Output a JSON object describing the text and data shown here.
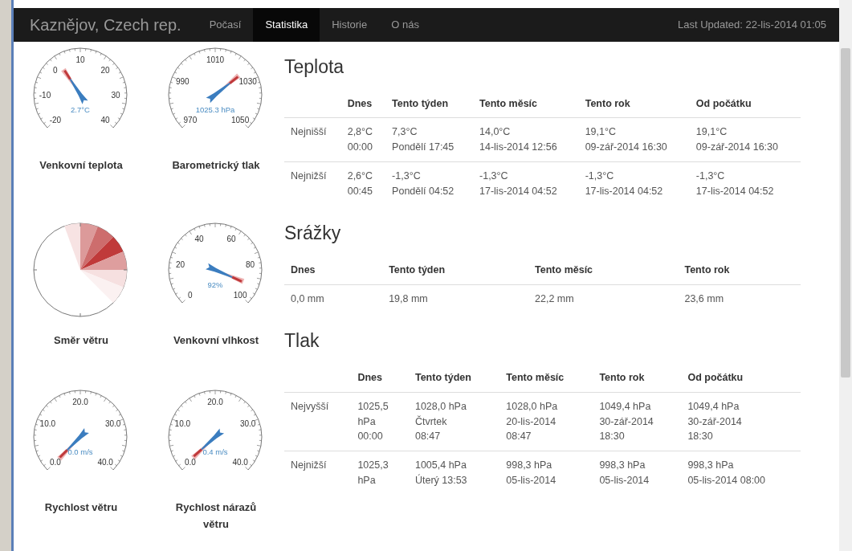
{
  "navbar": {
    "brand": "Kaznějov, Czech rep.",
    "items": [
      {
        "label": "Počasí",
        "selected": false
      },
      {
        "label": "Statistika",
        "selected": true
      },
      {
        "label": "Historie",
        "selected": false
      },
      {
        "label": "O nás",
        "selected": false
      }
    ],
    "last_updated": "Last Updated: 22-lis-2014 01:05"
  },
  "gauge_rows": [
    [
      {
        "kind": "dial",
        "title": "Venkovní teplota",
        "ticks": [
          "-20",
          "-10",
          "0",
          "10",
          "20",
          "30",
          "40"
        ],
        "reading": "2.7°C"
      },
      {
        "kind": "dial",
        "title": "Barometrický tlak",
        "ticks": [
          "970",
          "990",
          "1010",
          "1030",
          "1050"
        ],
        "reading": "1025.3 hPa"
      }
    ],
    [
      {
        "kind": "rose",
        "title": "Směr větru"
      },
      {
        "kind": "dial",
        "title": "Venkovní vlhkost",
        "ticks": [
          "0",
          "20",
          "40",
          "60",
          "80",
          "100"
        ],
        "reading": "92%"
      }
    ],
    [
      {
        "kind": "dial",
        "title": "Rychlost větru",
        "ticks": [
          "0.0",
          "10.0",
          "20.0",
          "30.0",
          "40.0"
        ],
        "reading": "0.0 m/s"
      },
      {
        "kind": "dial",
        "title": "Rychlost nárazů větru",
        "ticks": [
          "0.0",
          "10.0",
          "20.0",
          "30.0",
          "40.0"
        ],
        "reading": "0.4 m/s"
      }
    ]
  ],
  "sections": [
    {
      "title": "Teplota",
      "columns": [
        "Dnes",
        "Tento týden",
        "Tento měsíc",
        "Tento rok",
        "Od počátku"
      ],
      "rows": [
        {
          "label": "Nejnišší",
          "cells": [
            [
              "2,8°C",
              "00:00"
            ],
            [
              "7,3°C",
              "Pondělí 17:45"
            ],
            [
              "14,0°C",
              "14-lis-2014 12:56"
            ],
            [
              "19,1°C",
              "09-zář-2014 16:30"
            ],
            [
              "19,1°C",
              "09-zář-2014 16:30"
            ]
          ]
        },
        {
          "label": "Nejnižší",
          "cells": [
            [
              "2,6°C",
              "00:45"
            ],
            [
              "-1,3°C",
              "Pondělí 04:52"
            ],
            [
              "-1,3°C",
              "17-lis-2014 04:52"
            ],
            [
              "-1,3°C",
              "17-lis-2014 04:52"
            ],
            [
              "-1,3°C",
              "17-lis-2014 04:52"
            ]
          ]
        }
      ]
    },
    {
      "title": "Srážky",
      "columns": [
        "Dnes",
        "Tento týden",
        "Tento měsíc",
        "Tento rok"
      ],
      "rows": [
        {
          "cells": [
            [
              "0,0 mm"
            ],
            [
              "19,8 mm"
            ],
            [
              "22,2 mm"
            ],
            [
              "23,6 mm"
            ]
          ]
        }
      ]
    },
    {
      "title": "Tlak",
      "columns": [
        "Dnes",
        "Tento týden",
        "Tento měsíc",
        "Tento rok",
        "Od počátku"
      ],
      "rows": [
        {
          "label": "Nejvyšší",
          "cells": [
            [
              "1025,5",
              "hPa",
              "00:00"
            ],
            [
              "1028,0 hPa",
              "Čtvrtek",
              "08:47"
            ],
            [
              "1028,0 hPa",
              "20-lis-2014",
              "08:47"
            ],
            [
              "1049,4 hPa",
              "30-zář-2014",
              "18:30"
            ],
            [
              "1049,4 hPa",
              "30-zář-2014",
              "18:30"
            ]
          ]
        },
        {
          "label": "Nejnižší",
          "cells": [
            [
              "1025,3",
              "hPa"
            ],
            [
              "1005,4 hPa",
              "Úterý 13:53"
            ],
            [
              "998,3 hPa",
              "05-lis-2014"
            ],
            [
              "998,3 hPa",
              "05-lis-2014"
            ],
            [
              "998,3 hPa",
              "05-lis-2014 08:00"
            ]
          ]
        }
      ]
    }
  ]
}
